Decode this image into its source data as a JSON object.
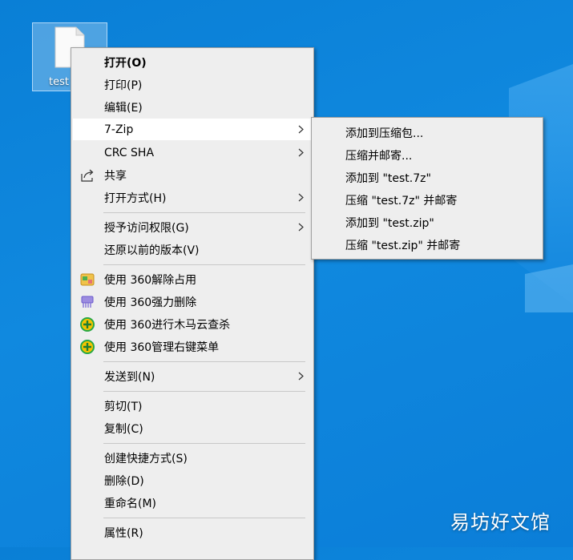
{
  "desktop": {
    "file_label": "test",
    "watermark": "易坊好文馆"
  },
  "context_menu": {
    "items": [
      {
        "label": "打开(O)"
      },
      {
        "label": "打印(P)"
      },
      {
        "label": "编辑(E)"
      },
      {
        "label": "7-Zip"
      },
      {
        "label": "CRC SHA"
      },
      {
        "label": "共享",
        "icon": "share-icon"
      },
      {
        "label": "打开方式(H)"
      },
      {
        "label": "授予访问权限(G)"
      },
      {
        "label": "还原以前的版本(V)"
      },
      {
        "label": "使用 360解除占用",
        "icon": "360-unlock-icon"
      },
      {
        "label": "使用 360强力删除",
        "icon": "360-shred-icon"
      },
      {
        "label": "使用 360进行木马云查杀",
        "icon": "360-scan-icon"
      },
      {
        "label": "使用 360管理右键菜单",
        "icon": "360-manage-icon"
      },
      {
        "label": "发送到(N)"
      },
      {
        "label": "剪切(T)"
      },
      {
        "label": "复制(C)"
      },
      {
        "label": "创建快捷方式(S)"
      },
      {
        "label": "删除(D)"
      },
      {
        "label": "重命名(M)"
      },
      {
        "label": "属性(R)"
      }
    ]
  },
  "zip_submenu": {
    "items": [
      {
        "label": "添加到压缩包..."
      },
      {
        "label": "压缩并邮寄..."
      },
      {
        "label": "添加到 \"test.7z\""
      },
      {
        "label": "压缩 \"test.7z\" 并邮寄"
      },
      {
        "label": "添加到 \"test.zip\""
      },
      {
        "label": "压缩 \"test.zip\" 并邮寄"
      }
    ]
  },
  "colors": {
    "desktop_bg": "#0a7fd6",
    "menu_bg": "#eeeeee",
    "highlight": "#ffffff",
    "icon_360_green": "#27a844",
    "icon_360_yellow": "#f5c400"
  }
}
